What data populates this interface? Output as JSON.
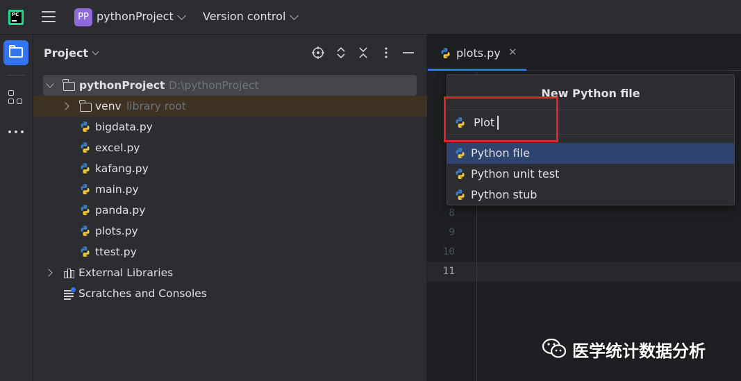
{
  "titlebar": {
    "logo_text": "PC",
    "project_badge": "PP",
    "project_name": "pythonProject",
    "vcs_label": "Version control",
    "icons": [
      "pycharm-logo-icon",
      "hamburger-menu-icon",
      "chevron-down-icon"
    ]
  },
  "toolstrip": {
    "icons": [
      "folder-icon",
      "structure-icon",
      "more-icon"
    ]
  },
  "project_panel": {
    "title": "Project",
    "toolbar_icons": [
      "locate-icon",
      "expand-all-icon",
      "collapse-all-icon",
      "options-icon",
      "hide-icon"
    ],
    "root": {
      "label": "pythonProject",
      "path": "D:\\pythonProject"
    },
    "venv": {
      "label": "venv",
      "sub": "library root"
    },
    "files": [
      "bigdata.py",
      "excel.py",
      "kafang.py",
      "main.py",
      "panda.py",
      "plots.py",
      "ttest.py"
    ],
    "external_libraries": "External Libraries",
    "scratches": "Scratches and Consoles"
  },
  "editor": {
    "tab_label": "plots.py",
    "tab_close": "✕",
    "line_numbers": [
      "8",
      "9",
      "10",
      "11"
    ],
    "current_line": "11"
  },
  "popup": {
    "title": "New Python file",
    "input_value": "Plot",
    "items": [
      {
        "label": "Python file",
        "active": true
      },
      {
        "label": "Python unit test",
        "active": false
      },
      {
        "label": "Python stub",
        "active": false
      }
    ]
  },
  "watermark": {
    "text": "医学统计数据分析"
  },
  "colors": {
    "accent": "#3574f0",
    "project_badge": "#8f6bd8",
    "highlight_box": "#e0252b",
    "popup_selection": "#2e436e"
  }
}
